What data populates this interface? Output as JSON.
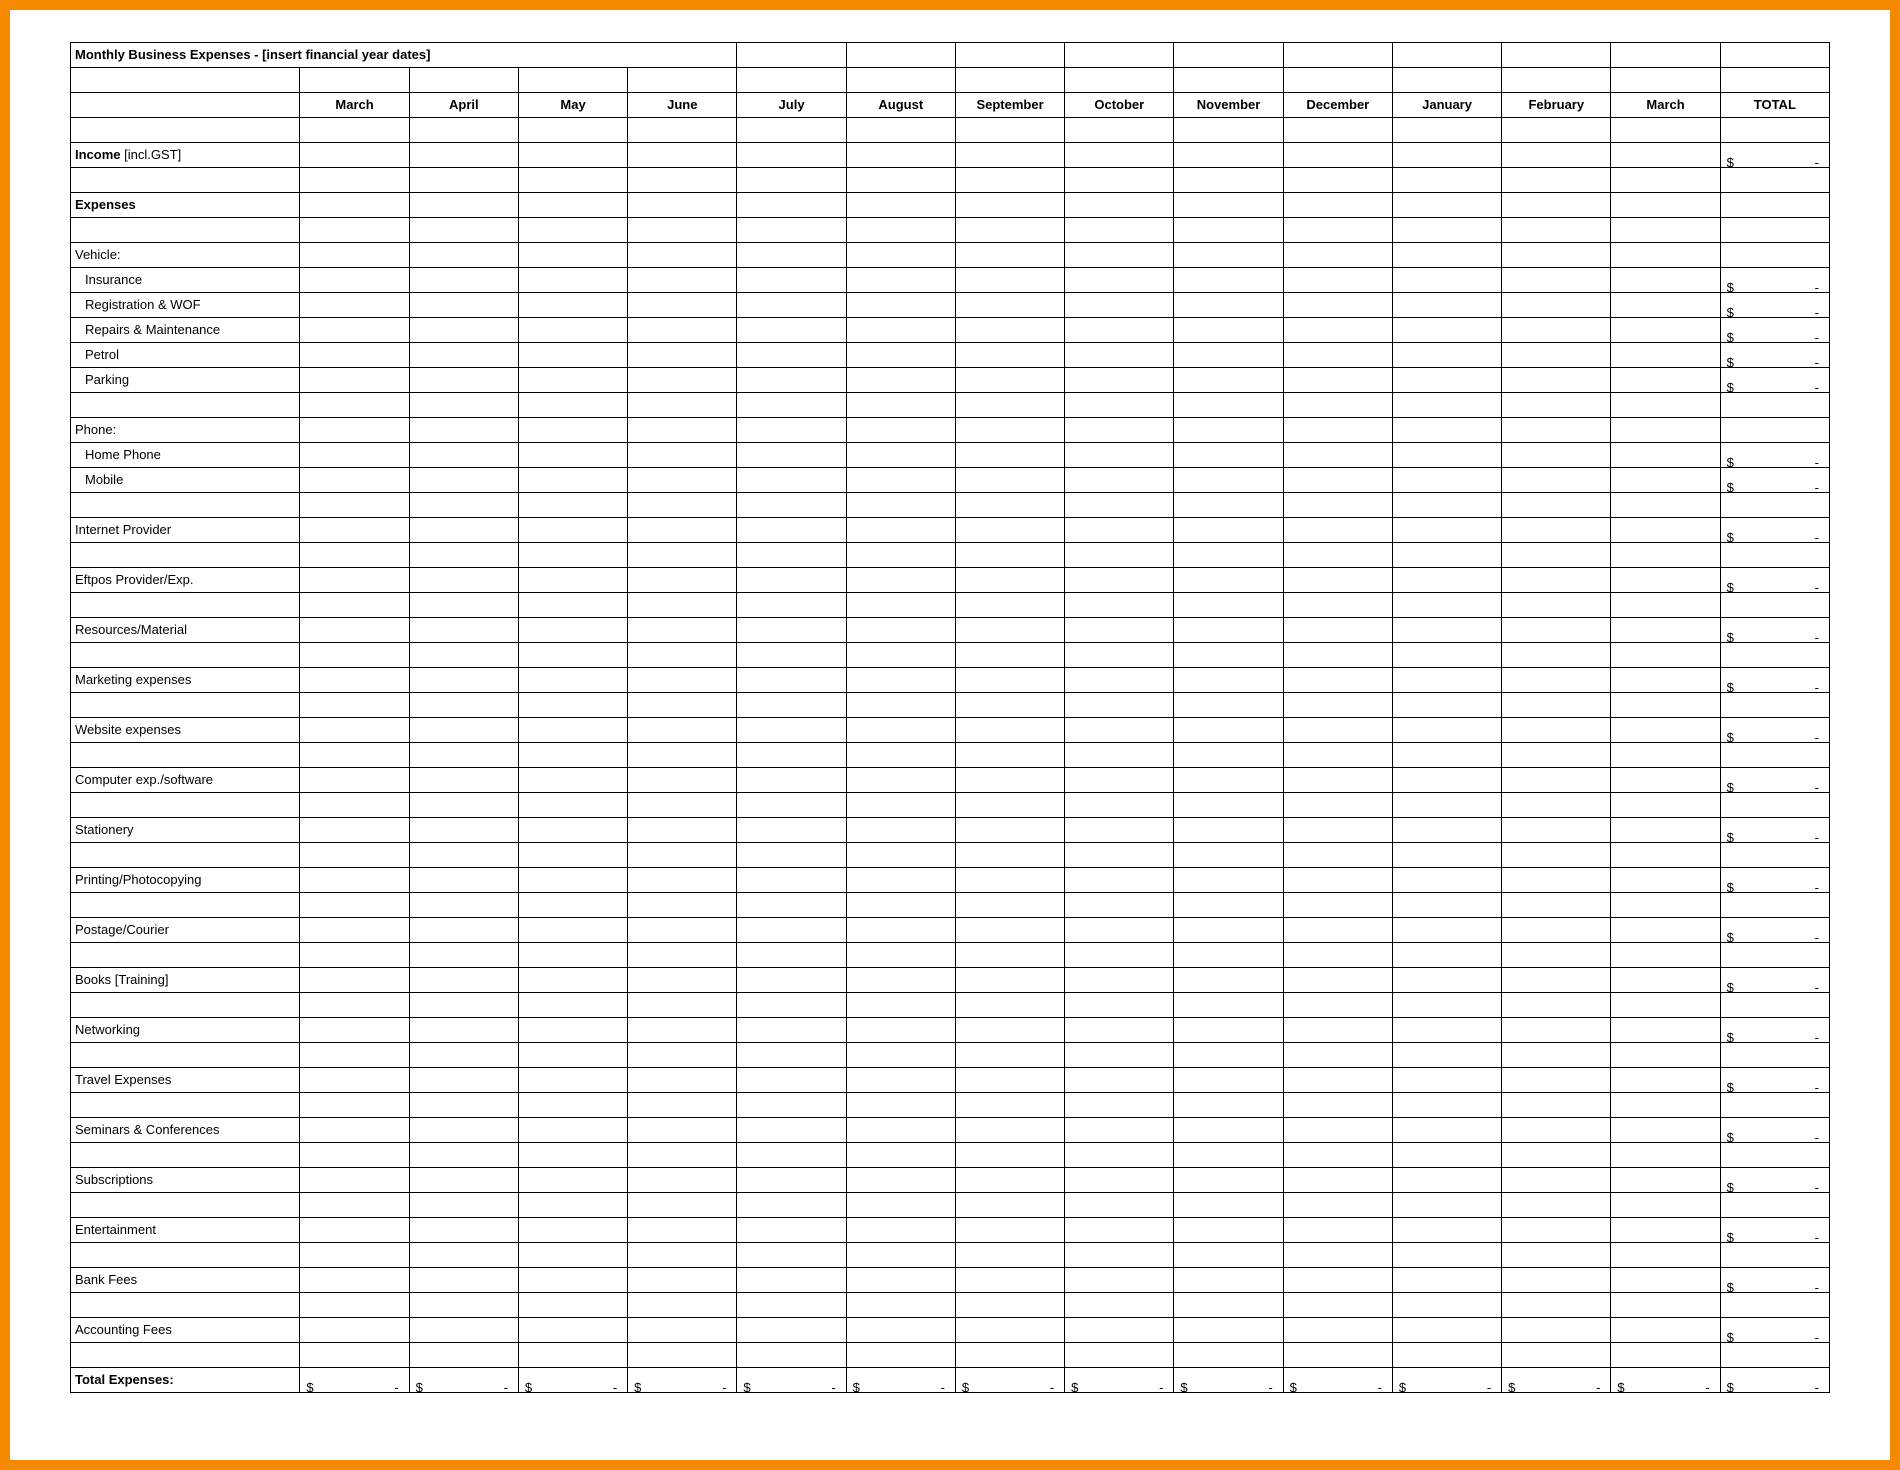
{
  "title": "Monthly Business Expenses - [insert financial year dates]",
  "months": [
    "March",
    "April",
    "May",
    "June",
    "July",
    "August",
    "September",
    "October",
    "November",
    "December",
    "January",
    "February",
    "March"
  ],
  "totalHeader": "TOTAL",
  "incomeLabel": "Income",
  "incomeSuffix": " [incl.GST]",
  "expensesHeader": "Expenses",
  "vehicleHeader": "Vehicle:",
  "vehicleItems": [
    "Insurance",
    "Registration & WOF",
    "Repairs & Maintenance",
    "Petrol",
    "Parking"
  ],
  "phoneHeader": "Phone:",
  "phoneItems": [
    "Home Phone",
    "Mobile"
  ],
  "singleItems": [
    "Internet Provider",
    "Eftpos Provider/Exp.",
    "Resources/Material",
    "Marketing expenses",
    "Website expenses",
    "Computer exp./software",
    "Stationery",
    "Printing/Photocopying",
    "Postage/Courier",
    "Books [Training]",
    "Networking",
    "Travel Expenses",
    "Seminars & Conferences",
    "Subscriptions",
    "Entertainment",
    "Bank Fees",
    "Accounting Fees"
  ],
  "totalExpensesLabel": "Total Expenses:",
  "currencySymbol": "$",
  "emptyDash": "-"
}
